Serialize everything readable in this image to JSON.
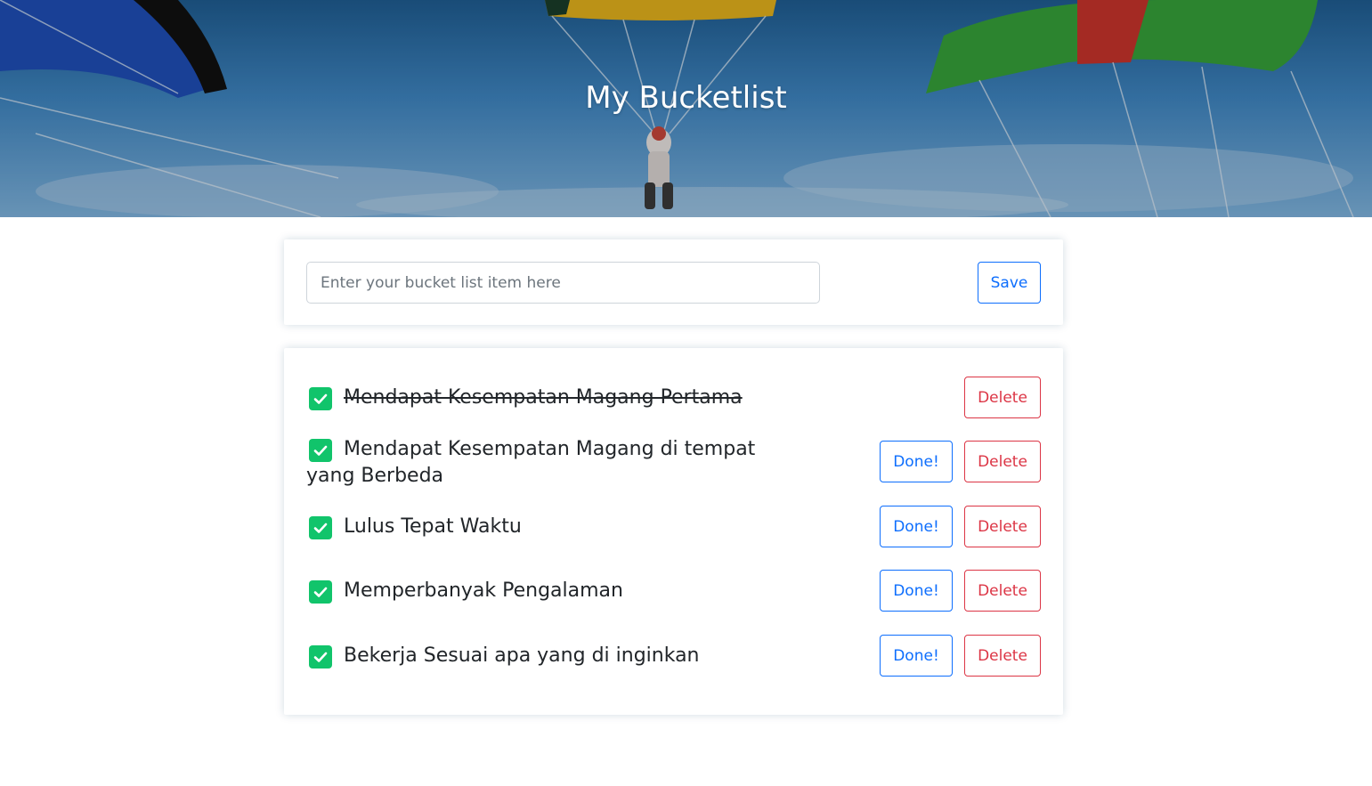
{
  "header": {
    "title": "My Bucketlist"
  },
  "form": {
    "input_placeholder": "Enter your bucket list item here",
    "input_value": "",
    "save_label": "Save"
  },
  "list": {
    "done_label": "Done!",
    "delete_label": "Delete",
    "items": [
      {
        "text": "Mendapat Kesempatan Magang Pertama",
        "completed": true
      },
      {
        "text": "Mendapat Kesempatan Magang di tempat yang Berbeda",
        "completed": false
      },
      {
        "text": "Lulus Tepat Waktu",
        "completed": false
      },
      {
        "text": "Memperbanyak Pengalaman",
        "completed": false
      },
      {
        "text": "Bekerja Sesuai apa yang di inginkan",
        "completed": false
      }
    ]
  },
  "icons": {
    "item_checkbox": "check-square-icon"
  },
  "colors": {
    "primary": "#0d6efd",
    "danger": "#dc3545",
    "check": "#11c46b"
  }
}
